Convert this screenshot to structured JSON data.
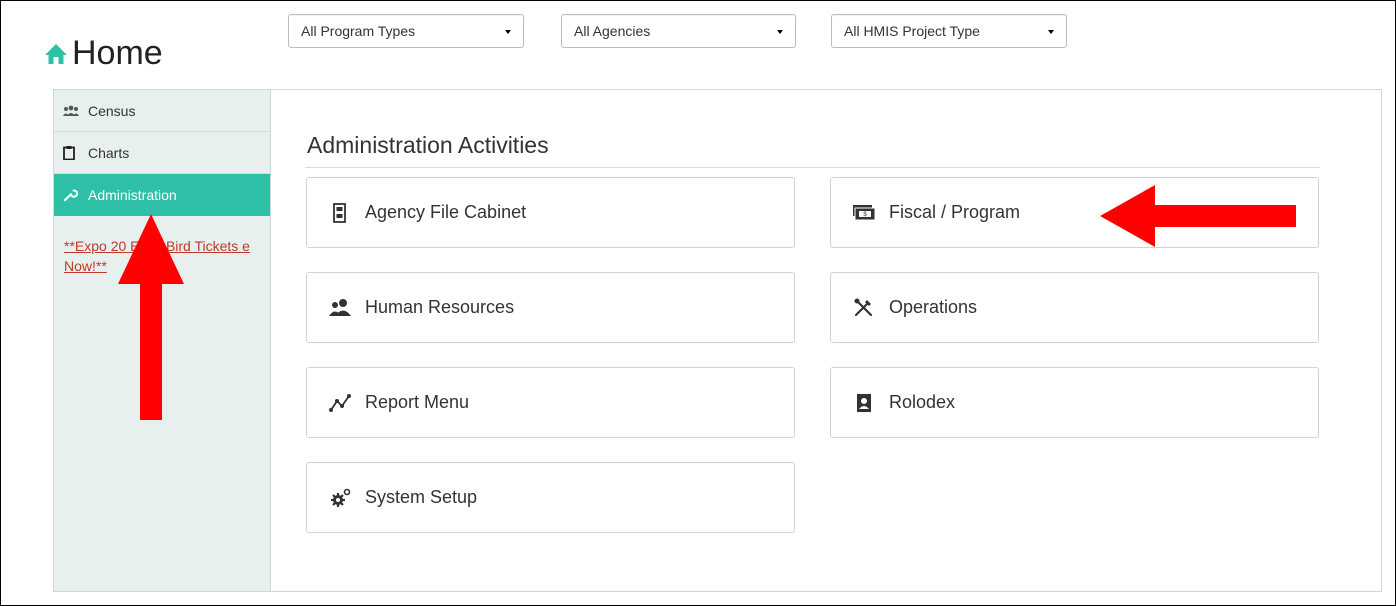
{
  "header": {
    "title": "Home",
    "home_icon": "home-icon"
  },
  "filters": [
    {
      "label": "All Program Types"
    },
    {
      "label": "All Agencies"
    },
    {
      "label": "All HMIS Project Type"
    }
  ],
  "sidebar": {
    "items": [
      {
        "label": "Census",
        "icon": "people-icon"
      },
      {
        "label": "Charts",
        "icon": "clipboard-icon"
      },
      {
        "label": "Administration",
        "icon": "wrench-icon",
        "active": true
      }
    ],
    "promo_link": "**Expo 20   Early Bird Tickets      e Now!**"
  },
  "main": {
    "heading": "Administration Activities",
    "tiles": [
      {
        "label": "Agency File Cabinet",
        "icon": "file-cabinet-icon"
      },
      {
        "label": "Fiscal / Program",
        "icon": "money-icon"
      },
      {
        "label": "Human Resources",
        "icon": "people-icon"
      },
      {
        "label": "Operations",
        "icon": "tools-icon"
      },
      {
        "label": "Report Menu",
        "icon": "chart-line-icon"
      },
      {
        "label": "Rolodex",
        "icon": "contact-book-icon"
      },
      {
        "label": "System Setup",
        "icon": "gears-icon"
      }
    ]
  },
  "colors": {
    "accent": "#2dc0a6",
    "sidebar_bg": "#e8efef",
    "annotation_arrow": "#ff0000",
    "link": "#c0392b"
  }
}
